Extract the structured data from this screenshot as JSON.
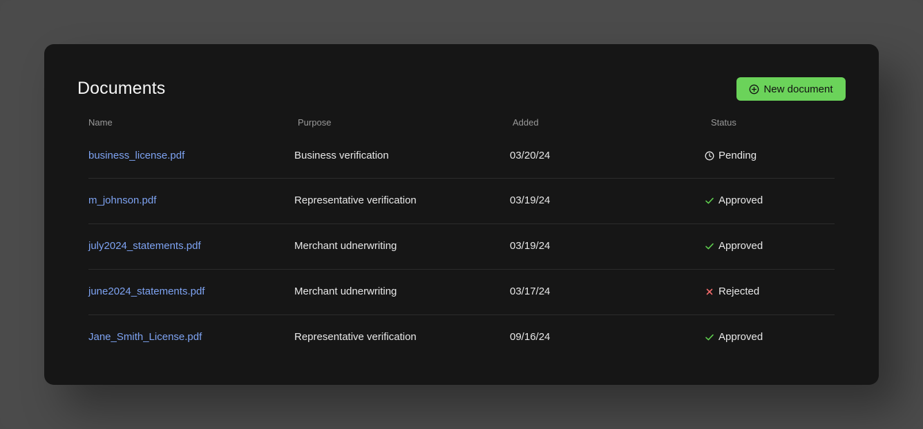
{
  "header": {
    "title": "Documents",
    "new_button_label": "New document"
  },
  "table": {
    "columns": [
      "Name",
      "Purpose",
      "Added",
      "Status"
    ],
    "rows": [
      {
        "name": "business_license.pdf",
        "purpose": "Business verification",
        "added": "03/20/24",
        "status": "Pending",
        "status_icon": "clock-icon"
      },
      {
        "name": "m_johnson.pdf",
        "purpose": "Representative verification",
        "added": "03/19/24",
        "status": "Approved",
        "status_icon": "check-icon"
      },
      {
        "name": "july2024_statements.pdf",
        "purpose": "Merchant udnerwriting",
        "added": "03/19/24",
        "status": "Approved",
        "status_icon": "check-icon"
      },
      {
        "name": "june2024_statements.pdf",
        "purpose": "Merchant udnerwriting",
        "added": "03/17/24",
        "status": "Rejected",
        "status_icon": "x-icon"
      },
      {
        "name": "Jane_Smith_License.pdf",
        "purpose": "Representative verification",
        "added": "09/16/24",
        "status": "Approved",
        "status_icon": "check-icon"
      }
    ]
  },
  "colors": {
    "accent_button": "#6bd35a",
    "link": "#7ea3f2",
    "approved": "#5fce4f",
    "rejected": "#f06a6a",
    "pending": "#e8e8e8"
  }
}
